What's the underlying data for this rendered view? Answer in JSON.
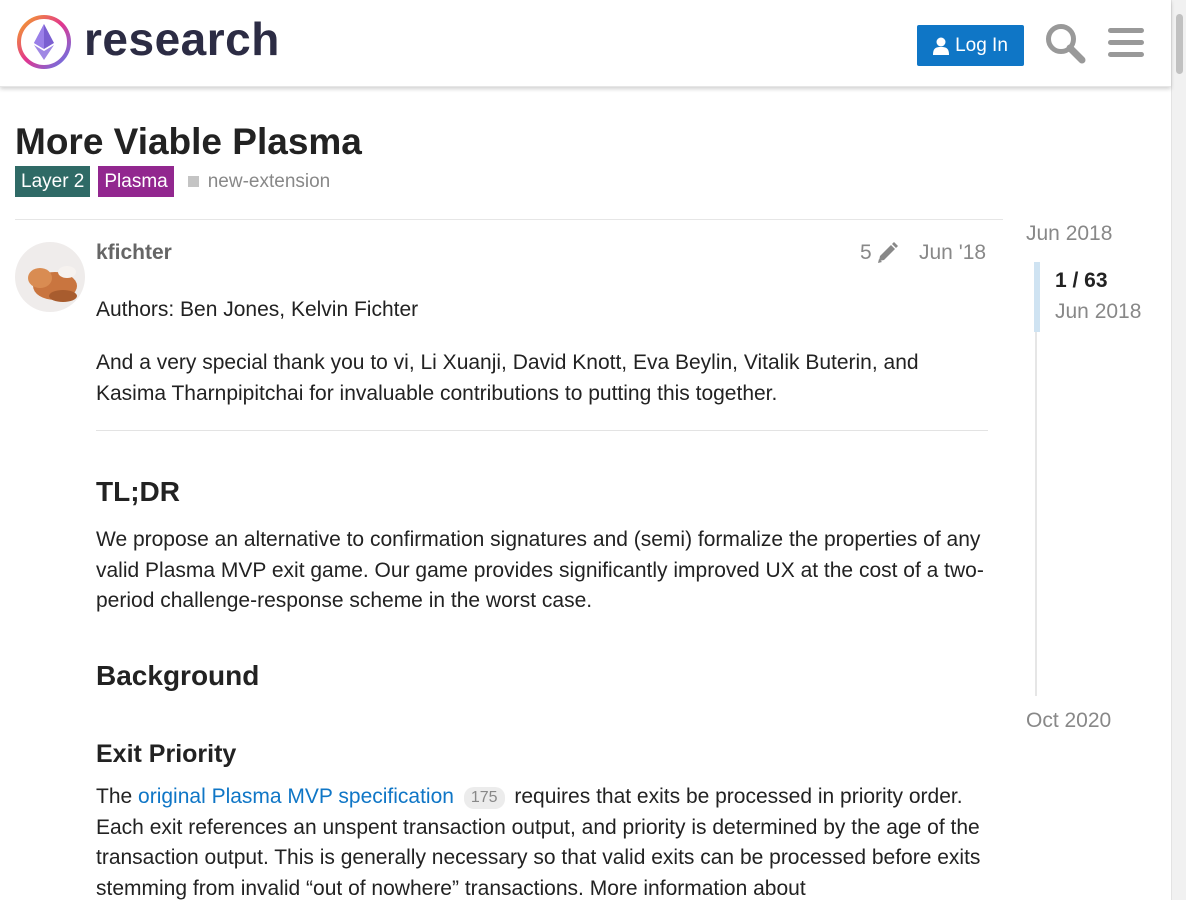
{
  "header": {
    "logo_text": "research",
    "login_label": "Log In",
    "icons": {
      "search": "search-icon",
      "menu": "hamburger-menu-icon",
      "login": "user-icon"
    }
  },
  "topic": {
    "title": "More Viable Plasma",
    "categories": [
      {
        "label": "Layer 2",
        "color": "#2f6a66"
      },
      {
        "label": "Plasma",
        "color": "#92278f"
      }
    ],
    "tag": "new-extension"
  },
  "post": {
    "username": "kfichter",
    "edit_count": "5",
    "date": "Jun '18",
    "authors": "Authors: Ben Jones, Kelvin Fichter",
    "thanks": "And a very special thank you to vi, Li Xuanji, David Knott, Eva Beylin, Vitalik Buterin, and Kasima Tharnpipitchai for invaluable contributions to putting this together.",
    "tldr_heading": "TL;DR",
    "tldr_text": "We propose an alternative to confirmation signatures and (semi) formalize the properties of any valid Plasma MVP exit game. Our game provides significantly improved UX at the cost of a two-period challenge-response scheme in the worst case.",
    "background_heading": "Background",
    "exit_heading": "Exit Priority",
    "exit_prefix": "The",
    "exit_link": "original Plasma MVP specification",
    "exit_link_count": "175",
    "exit_text": "requires that exits be processed in priority order. Each exit references an unspent transaction output, and priority is determined by the age of the transaction output. This is generally necessary so that valid exits can be processed before exits stemming from invalid “out of nowhere” transactions. More information about"
  },
  "timeline": {
    "start": "Jun 2018",
    "position": "1 / 63",
    "position_date": "Jun 2018",
    "end": "Oct 2020"
  },
  "colors": {
    "accent": "#0f76c6"
  }
}
